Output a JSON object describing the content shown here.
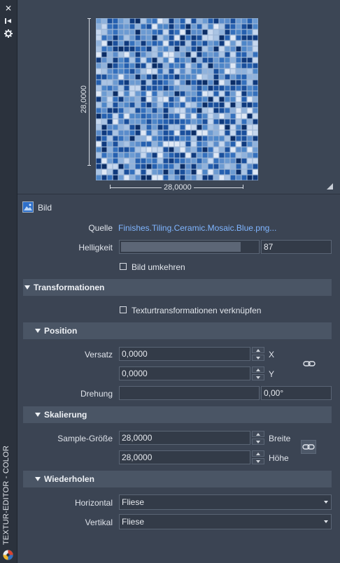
{
  "palette": {
    "panel": "#3b4453",
    "header": "#4a5565",
    "field": "#333b48",
    "link": "#7fb5ff",
    "slider_fill": "#5c6676",
    "tile_dark": "#123f87",
    "tile_light": "#c6d7ee"
  },
  "strip": {
    "close_icon": "close-icon",
    "collapse_icon": "pin-icon",
    "settings_icon": "gear-icon",
    "title": "TEXTUR-EDITOR - COLOR"
  },
  "preview": {
    "width_label": "28,0000",
    "height_label": "28,0000"
  },
  "image_row": {
    "label": "Bild"
  },
  "source": {
    "label": "Quelle",
    "value": "Finishes.Tiling.Ceramic.Mosaic.Blue.png..."
  },
  "brightness": {
    "label": "Helligkeit",
    "value": "87",
    "level": 0.87
  },
  "invert": {
    "label": "Bild umkehren",
    "checked": false
  },
  "transformations": {
    "header": "Transformationen",
    "link_label": "Texturtransformationen verknüpfen",
    "link_checked": false
  },
  "position": {
    "header": "Position",
    "offset_label": "Versatz",
    "offset_x": "0,0000",
    "offset_y": "0,0000",
    "x_axis": "X",
    "y_axis": "Y",
    "rotation_label": "Drehung",
    "rotation_value": "0,00°"
  },
  "scaling": {
    "header": "Skalierung",
    "sample_label": "Sample-Größe",
    "width_value": "28,0000",
    "height_value": "28,0000",
    "width_axis": "Breite",
    "height_axis": "Höhe"
  },
  "repeat": {
    "header": "Wiederholen",
    "horizontal_label": "Horizontal",
    "horizontal_value": "Fliese",
    "vertical_label": "Vertikal",
    "vertical_value": "Fliese"
  }
}
